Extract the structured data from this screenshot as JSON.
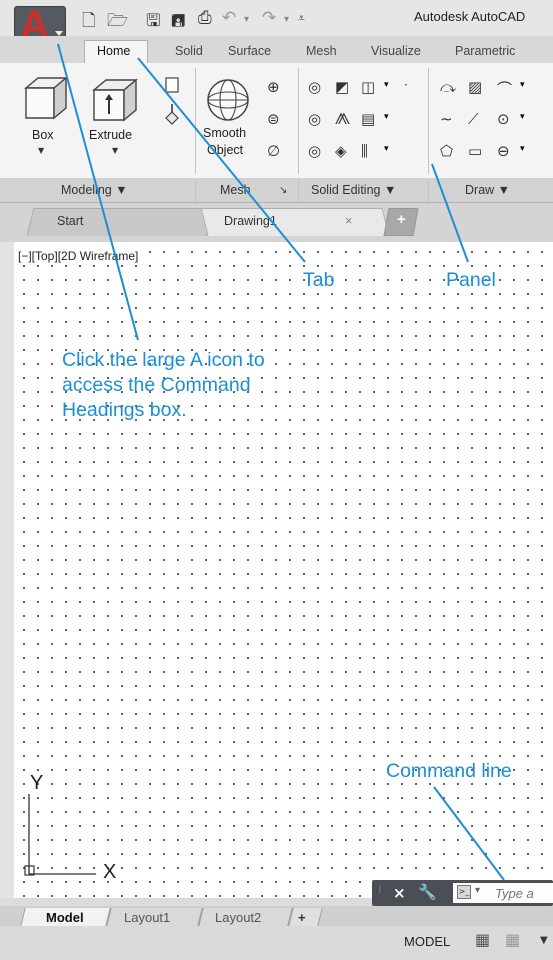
{
  "app": {
    "title": "Autodesk AutoCAD",
    "logo_letter": "A"
  },
  "ribbon": {
    "tabs": [
      "Home",
      "Solid",
      "Surface",
      "Mesh",
      "Visualize",
      "Parametric"
    ],
    "active_tab": "Home",
    "buttons": {
      "box": "Box",
      "extrude": "Extrude",
      "smooth_line1": "Smooth",
      "smooth_line2": "Object"
    },
    "panels": [
      "Modeling ▼",
      "Mesh",
      "Solid Editing ▼",
      "Draw ▼"
    ],
    "mesh_launcher": "↘"
  },
  "file_tabs": {
    "start": "Start",
    "drawing": "Drawing1",
    "close": "×",
    "new": "+"
  },
  "viewport": {
    "label": "[−][Top][2D Wireframe]",
    "ucs_y": "Y",
    "ucs_x": "X"
  },
  "callouts": {
    "tab": "Tab",
    "panel": "Panel",
    "a_icon_line1": "Click the large A icon to",
    "a_icon_line2": "access the Command",
    "a_icon_line3": "Headings box.",
    "command_line": "Command line"
  },
  "command_line": {
    "placeholder": "Type a"
  },
  "layout_tabs": [
    "Model",
    "Layout1",
    "Layout2",
    "+"
  ],
  "status": {
    "model": "MODEL"
  },
  "colors": {
    "callout": "#1a8fd6",
    "app_button": "#555a60",
    "logo": "#c9302c"
  }
}
